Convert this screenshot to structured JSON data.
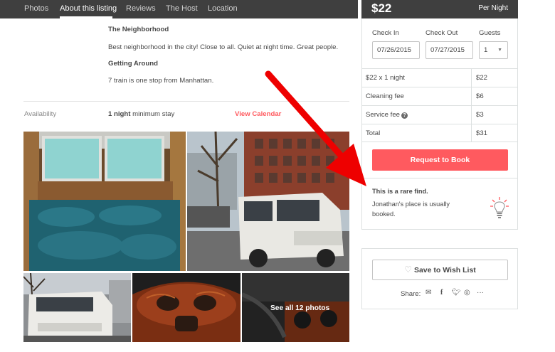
{
  "nav": {
    "tabs": [
      "Photos",
      "About this listing",
      "Reviews",
      "The Host",
      "Location"
    ],
    "active": "About this listing"
  },
  "about": {
    "neighborhood_heading": "The Neighborhood",
    "neighborhood_text": "Best neighborhood in the city! Close to all. Quiet at night time. Great people.",
    "getting_around_heading": "Getting Around",
    "getting_around_text": "7 train is one stop from Manhattan."
  },
  "availability": {
    "label": "Availability",
    "nights": "1 night",
    "min_stay": "minimum stay",
    "view_calendar": "View Calendar"
  },
  "photos": {
    "see_all": "See all 12 photos"
  },
  "booking": {
    "price": "$22",
    "per_night": "Per Night",
    "check_in_label": "Check In",
    "check_out_label": "Check Out",
    "guests_label": "Guests",
    "check_in_value": "07/26/2015",
    "check_out_value": "07/27/2015",
    "guests_value": "1",
    "rows": [
      {
        "label": "$22 x 1 night",
        "value": "$22"
      },
      {
        "label": "Cleaning fee",
        "value": "$6"
      },
      {
        "label": "Service fee",
        "value": "$3"
      },
      {
        "label": "Total",
        "value": "$31"
      }
    ],
    "request_button": "Request to Book",
    "rare_title": "This is a rare find.",
    "rare_line1": "Jonathan's place is usually",
    "rare_line2": "booked."
  },
  "wishlist": {
    "save_button": "Save to Wish List",
    "share_label": "Share:",
    "share_icons": [
      "email-icon",
      "facebook-icon",
      "twitter-icon",
      "messenger-icon",
      "more-icon"
    ]
  },
  "colors": {
    "accent": "#ff5a5f",
    "nav_bg": "#3f3f3f",
    "annotation_arrow": "#ee0000"
  }
}
